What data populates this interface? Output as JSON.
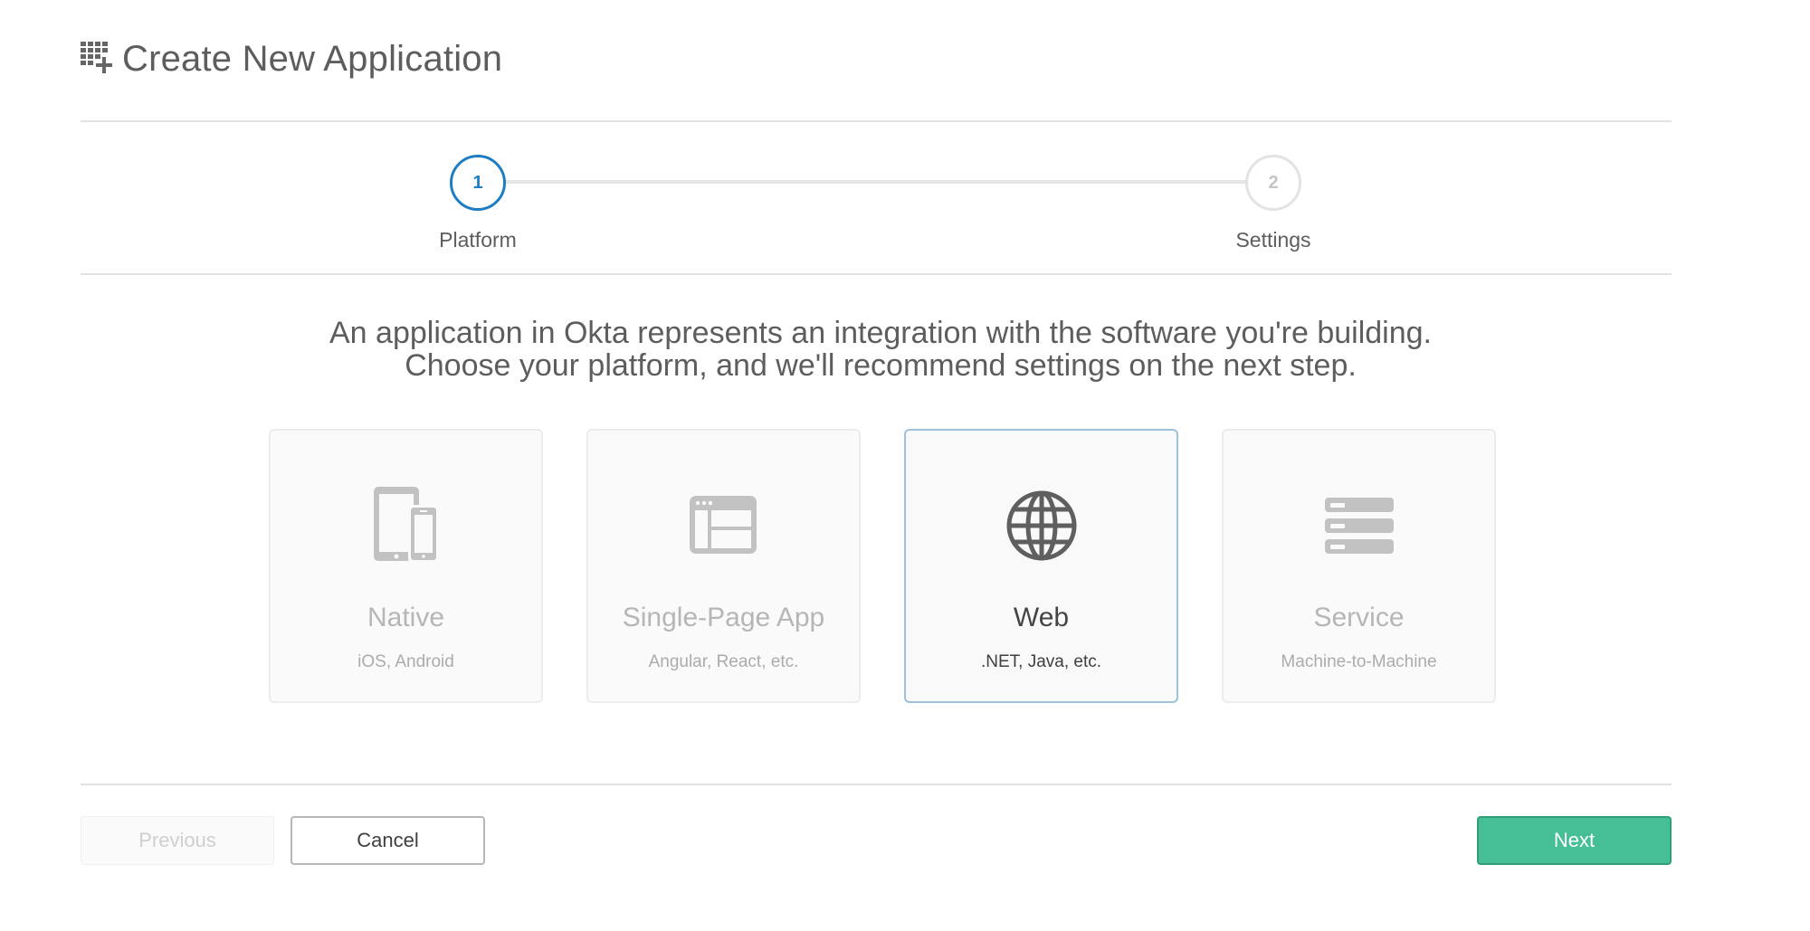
{
  "header": {
    "title": "Create New Application",
    "icon": "grid-plus-icon"
  },
  "stepper": {
    "steps": [
      {
        "number": "1",
        "label": "Platform",
        "state": "active"
      },
      {
        "number": "2",
        "label": "Settings",
        "state": "inactive"
      }
    ]
  },
  "intro": {
    "line1": "An application in Okta represents an integration with the software you're building.",
    "line2": "Choose your platform, and we'll recommend settings on the next step."
  },
  "platforms": [
    {
      "title": "Native",
      "subtitle": "iOS, Android",
      "icon": "devices-icon",
      "selected": false
    },
    {
      "title": "Single-Page App",
      "subtitle": "Angular, React, etc.",
      "icon": "browser-window-icon",
      "selected": false
    },
    {
      "title": "Web",
      "subtitle": ".NET, Java, etc.",
      "icon": "globe-icon",
      "selected": true
    },
    {
      "title": "Service",
      "subtitle": "Machine-to-Machine",
      "icon": "server-stack-icon",
      "selected": false
    }
  ],
  "actions": {
    "previous": "Previous",
    "cancel": "Cancel",
    "next": "Next"
  },
  "colors": {
    "accent": "#1f7ec1",
    "next_button": "#46bf96",
    "selected_border": "#9cc3d9"
  }
}
